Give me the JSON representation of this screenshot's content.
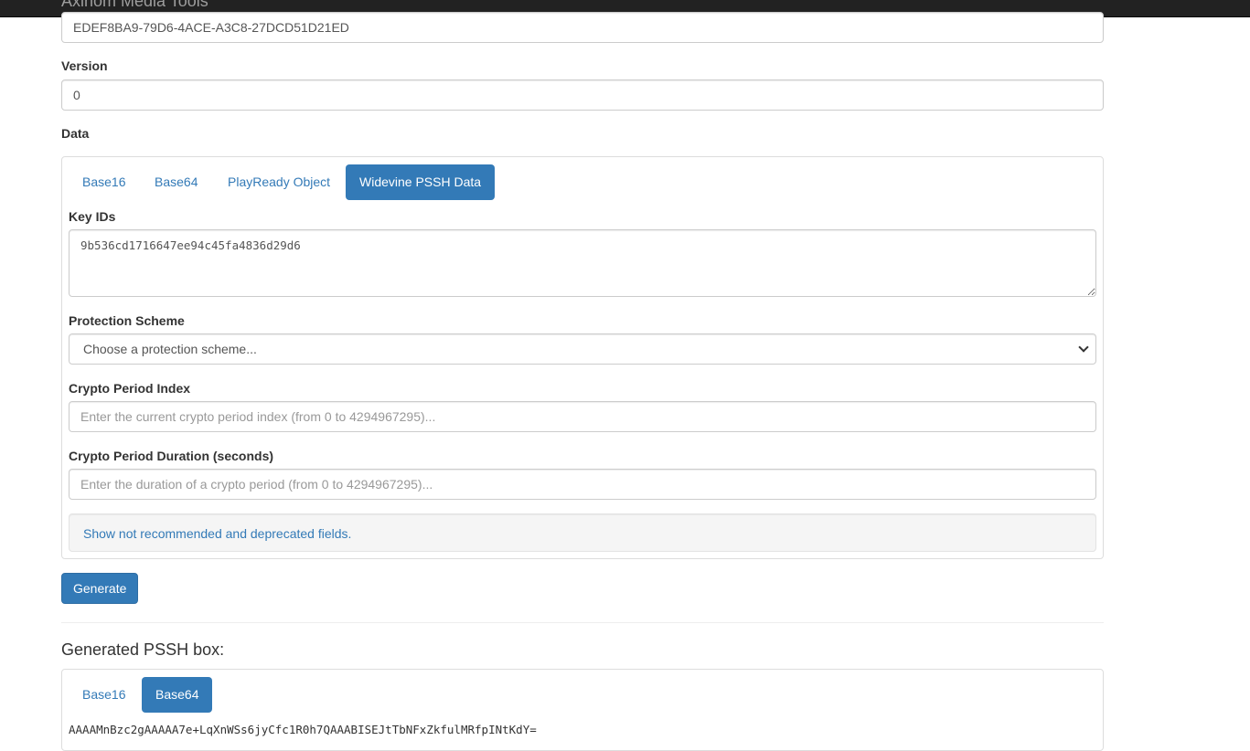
{
  "navbar": {
    "brand": "Axinom Media Tools"
  },
  "form": {
    "system_id_value": "EDEF8BA9-79D6-4ACE-A3C8-27DCD51D21ED",
    "version_label": "Version",
    "version_value": "0",
    "data_label": "Data",
    "data_tabs": [
      {
        "label": "Base16",
        "active": false
      },
      {
        "label": "Base64",
        "active": false
      },
      {
        "label": "PlayReady Object",
        "active": false
      },
      {
        "label": "Widevine PSSH Data",
        "active": true
      }
    ],
    "key_ids_label": "Key IDs",
    "key_ids_value": "9b536cd1716647ee94c45fa4836d29d6",
    "protection_scheme_label": "Protection Scheme",
    "protection_scheme_selected": "Choose a protection scheme...",
    "crypto_period_index_label": "Crypto Period Index",
    "crypto_period_index_placeholder": "Enter the current crypto period index (from 0 to 4294967295)...",
    "crypto_period_duration_label": "Crypto Period Duration (seconds)",
    "crypto_period_duration_placeholder": "Enter the duration of a crypto period (from 0 to 4294967295)...",
    "show_deprecated_link": "Show not recommended and deprecated fields.",
    "generate_label": "Generate"
  },
  "output": {
    "title": "Generated PSSH box:",
    "tabs": [
      {
        "label": "Base16",
        "active": false
      },
      {
        "label": "Base64",
        "active": true
      }
    ],
    "value": "AAAAMnBzc2gAAAAA7e+LqXnWSs6jyCfc1R0h7QAAABISEJtTbNFxZkfulMRfpINtKdY="
  },
  "colors": {
    "primary": "#337ab7",
    "navbar": "#222222",
    "text": "#333333",
    "border": "#cccccc"
  }
}
